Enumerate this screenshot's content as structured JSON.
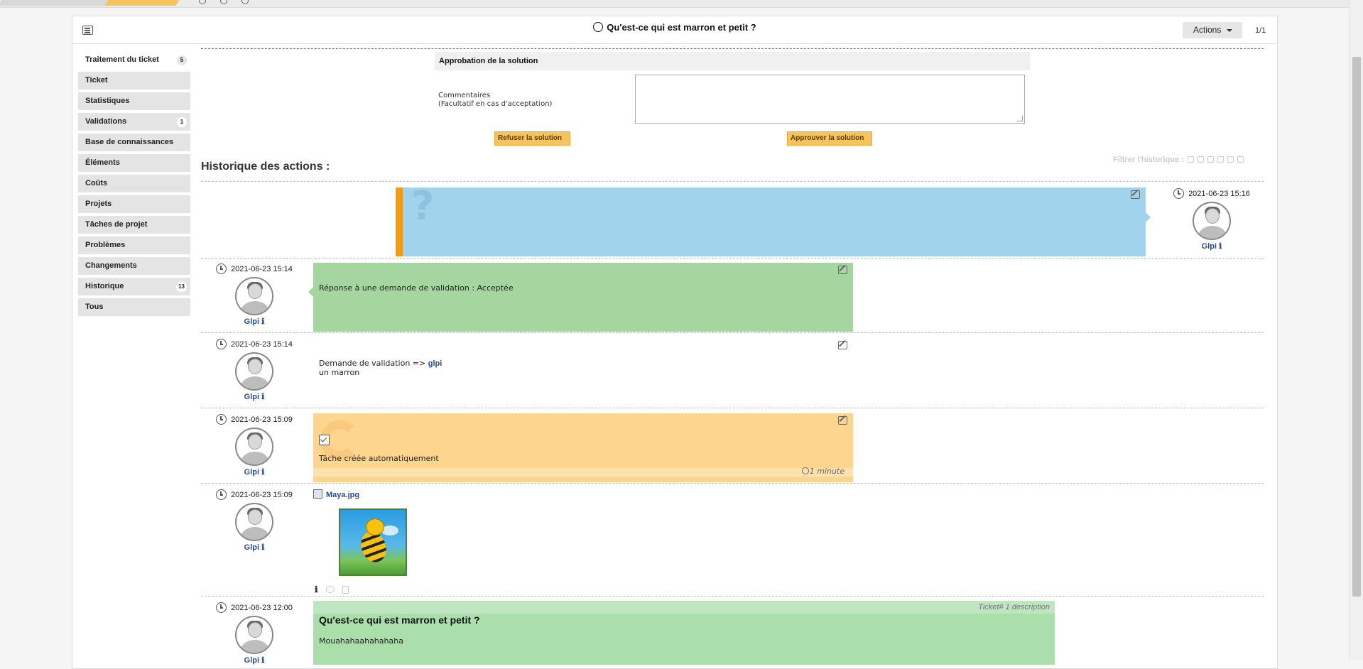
{
  "header": {
    "title": "Qu'est-ce qui est marron et petit ?",
    "actions_label": "Actions",
    "pager": "1/1"
  },
  "sidebar": {
    "items": [
      {
        "label": "Traitement du ticket",
        "badge": "5",
        "active": true
      },
      {
        "label": "Ticket",
        "badge": ""
      },
      {
        "label": "Statistiques",
        "badge": ""
      },
      {
        "label": "Validations",
        "badge": "1"
      },
      {
        "label": "Base de connaissances",
        "badge": ""
      },
      {
        "label": "Éléments",
        "badge": ""
      },
      {
        "label": "Coûts",
        "badge": ""
      },
      {
        "label": "Projets",
        "badge": ""
      },
      {
        "label": "Tâches de projet",
        "badge": ""
      },
      {
        "label": "Problèmes",
        "badge": ""
      },
      {
        "label": "Changements",
        "badge": ""
      },
      {
        "label": "Historique",
        "badge": "13"
      },
      {
        "label": "Tous",
        "badge": ""
      }
    ]
  },
  "approval": {
    "title": "Approbation de la solution",
    "comment_label_line1": "Commentaires",
    "comment_label_line2": "(Facultatif en cas d'acceptation)",
    "refuse_label": "Refuser la solution",
    "approve_label": "Approuver la solution"
  },
  "history": {
    "title": "Historique des actions :",
    "filter_label": "Filtrer l'historique :"
  },
  "timeline": {
    "solution": {
      "date": "2021-06-23 15:16",
      "user": "Glpi"
    },
    "validation_answer": {
      "date": "2021-06-23 15:14",
      "user": "Glpi",
      "text": "Réponse à une demande de validation : Acceptée"
    },
    "validation_request": {
      "date": "2021-06-23 15:14",
      "user": "Glpi",
      "text_prefix": "Demande de validation =>",
      "target": "glpi",
      "text_line2": "un marron"
    },
    "task": {
      "date": "2021-06-23 15:09",
      "user": "Glpi",
      "text": "Tâche créée automatiquement",
      "duration": "1 minute"
    },
    "document": {
      "date": "2021-06-23 15:09",
      "user": "Glpi",
      "filename": "Maya.jpg"
    },
    "description": {
      "date": "2021-06-23 12:00",
      "user": "Glpi",
      "label": "Ticket# 1 description",
      "title": "Qu'est-ce qui est marron et petit ?",
      "text": "Mouahahaahahahaha"
    }
  },
  "icons": {
    "info": "ℹ",
    "colors": {
      "accent": "#f7c35c",
      "solution": "#a2d3ec",
      "solution_border": "#f39c12",
      "answer": "#a5d6a0",
      "task": "#fdd58f",
      "description": "#aadfac",
      "link": "#2a4d8f"
    }
  }
}
